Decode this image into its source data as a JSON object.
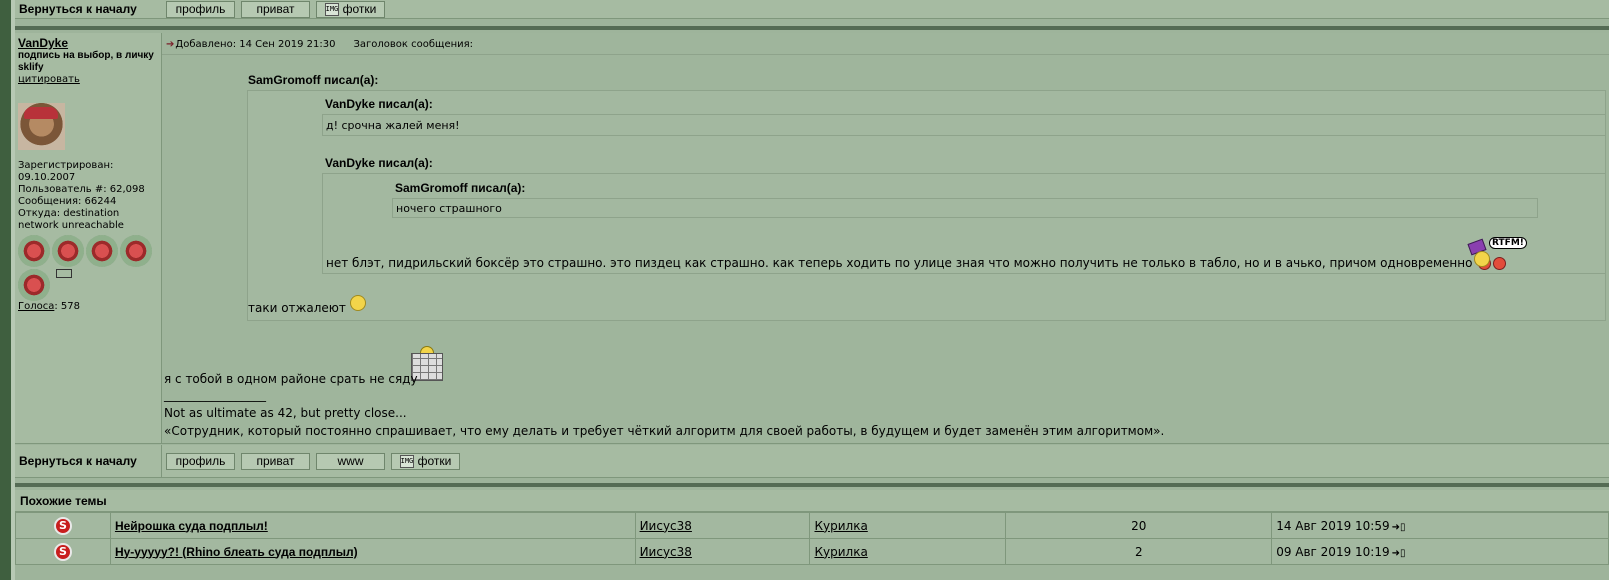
{
  "top_bar": {
    "back_label": "Вернуться к началу",
    "buttons": {
      "profile": "профиль",
      "private": "приват",
      "photos": "фотки"
    }
  },
  "post": {
    "author": {
      "name": "VanDyke",
      "signature": "подпись на выбор, в личку sklify",
      "quote_link": "цитировать",
      "registered_label": "Зарегистрирован:",
      "registered_date": "09.10.2007",
      "user_number": "Пользователь #: 62,098",
      "messages": "Сообщения: 66244",
      "from": "Откуда: destination network unreachable",
      "votes_link": "Голоса",
      "votes_count": ": 578"
    },
    "meta": {
      "posted": "Добавлено: 14 Сен 2019 21:30",
      "subject_label": "Заголовок сообщения:"
    },
    "quotes": {
      "outer_author": "SamGromoff писал(а):",
      "inner1_author": "VanDyke писал(а):",
      "inner1_text": "д! срочна жалей меня!",
      "inner2_author": "VanDyke писал(а):",
      "inner3_author": "SamGromoff писал(а):",
      "inner3_text": "ночего страшного",
      "inner2_text": "нет блэт, пидрильский боксёр это страшно. это пиздец как страшно. как теперь ходить по улице зная что можно получить не только в табло, но и в ачько, причом одновременно",
      "rtfm": "RTFM!",
      "outer_text": "таки отжалеют"
    },
    "reply_text": "я с тобой в одном районе срать не сяду",
    "sig_line": "_________________",
    "sig_text1": "Not as ultimate as 42, but pretty close...",
    "sig_text2": "«Сотрудник, который постоянно спрашивает, что ему делать и требует чёткий алгоритм для своей работы, в будущем и будет заменён этим алгоритмом»."
  },
  "bottom_bar": {
    "back_label": "Вернуться к началу",
    "buttons": {
      "profile": "профиль",
      "private": "приват",
      "www": "www",
      "photos": "фотки"
    }
  },
  "similar": {
    "title": "Похожие темы",
    "rows": [
      {
        "topic": "Нейрошка суда подплыл!",
        "author": "Иисус38",
        "forum": "Курилка",
        "replies": "20",
        "date": "14 Авг 2019 10:59"
      },
      {
        "topic": "Ну-ууууу?! (Rhino блеать суда подплыл)",
        "author": "Иисус38",
        "forum": "Курилка",
        "replies": "2",
        "date": "09 Авг 2019 10:19"
      }
    ]
  },
  "colors": {
    "page_bg": "#9cb39a",
    "dark_border": "#3f5f3f",
    "accent_red": "#c81e1e"
  }
}
